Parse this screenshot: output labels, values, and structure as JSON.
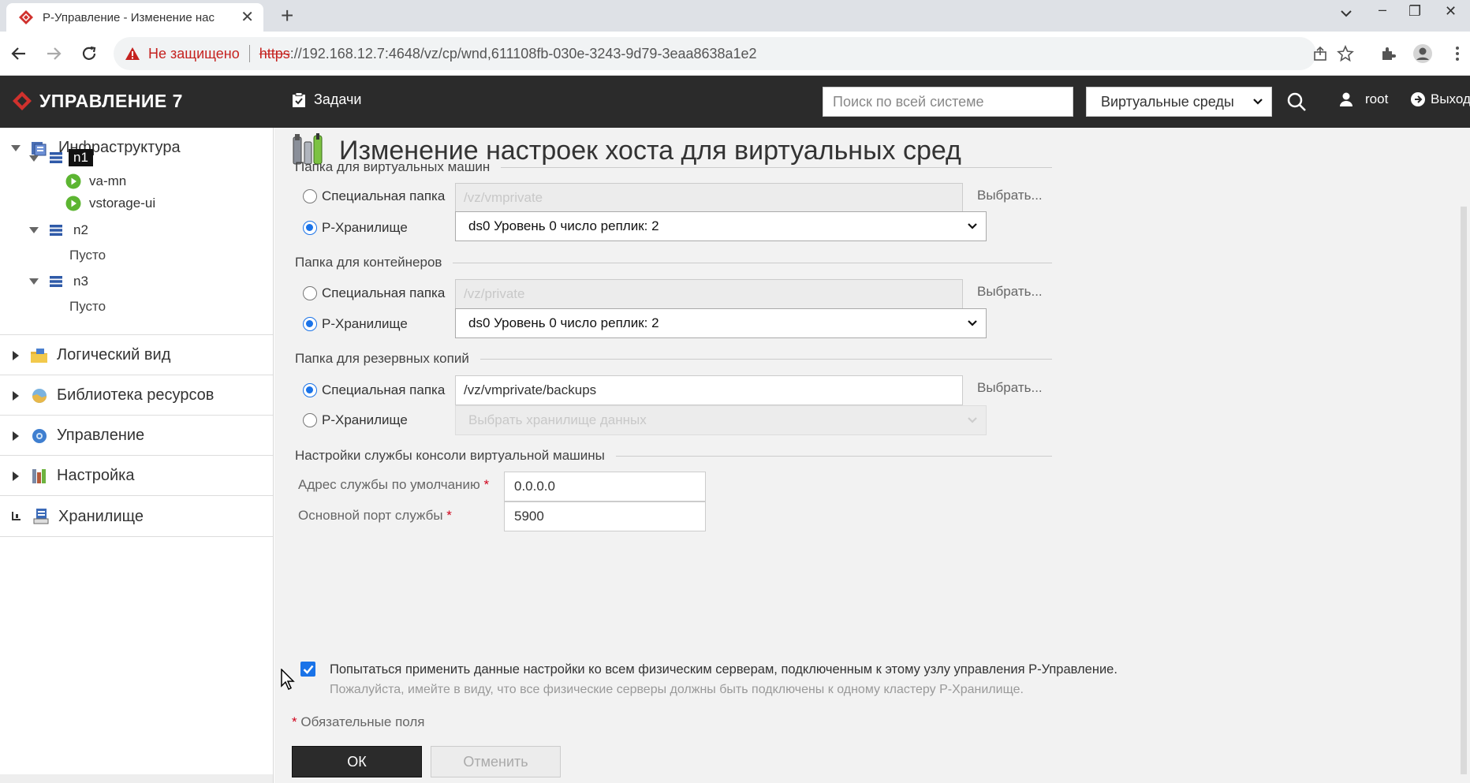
{
  "browser": {
    "tab_title": "Р-Управление - Изменение нас",
    "security_warning": "Не защищено",
    "url_scheme": "https",
    "url_rest": "://192.168.12.7:4648/vz/cp/wnd,611108fb-030e-3243-9d79-3eaa8638a1e2"
  },
  "header": {
    "app_title": "УПРАВЛЕНИЕ 7",
    "tasks_label": "Задачи",
    "search_placeholder": "Поиск по всей системе",
    "scope_select": "Виртуальные среды",
    "user": "root",
    "logout": "Выход"
  },
  "sidebar": {
    "infrastructure": "Инфраструктура",
    "nodes": [
      {
        "name": "n1",
        "children": [
          "va-mn",
          "vstorage-ui"
        ]
      },
      {
        "name": "n2",
        "empty": "Пусто"
      },
      {
        "name": "n3",
        "empty": "Пусто"
      }
    ],
    "sections": [
      "Логический вид",
      "Библиотека ресурсов",
      "Управление",
      "Настройка",
      "Хранилище"
    ]
  },
  "form": {
    "title": "Изменение настроек хоста для виртуальных сред",
    "vm_folder": {
      "heading": "Папка для виртуальных машин",
      "custom_label": "Специальная папка",
      "custom_value": "/vz/vmprivate",
      "storage_label": "Р-Хранилище",
      "storage_value": "ds0 Уровень 0 число реплик: 2",
      "selected": "storage"
    },
    "ct_folder": {
      "heading": "Папка для контейнеров",
      "custom_label": "Специальная папка",
      "custom_value": "/vz/private",
      "storage_label": "Р-Хранилище",
      "storage_value": "ds0 Уровень 0 число реплик: 2",
      "selected": "storage"
    },
    "backup_folder": {
      "heading": "Папка для резервных копий",
      "custom_label": "Специальная папка",
      "custom_value": "/vz/vmprivate/backups",
      "storage_label": "Р-Хранилище",
      "storage_value": "Выбрать хранилище данных",
      "selected": "custom"
    },
    "browse_label": "Выбрать...",
    "console": {
      "heading": "Настройки службы консоли виртуальной машины",
      "address_label": "Адрес службы по умолчанию",
      "address_value": "0.0.0.0",
      "port_label": "Основной порт службы",
      "port_value": "5900"
    },
    "apply_all_checked": true,
    "apply_all_text": "Попытаться применить данные настройки ко всем физическим серверам, подключенным к этому узлу управления Р-Управление.",
    "apply_all_note": "Пожалуйста, имейте в виду, что все физические серверы должны быть подключены к одному кластеру Р-Хранилище.",
    "required_mark": "*",
    "required_note": "Обязательные поля",
    "ok": "ОК",
    "cancel": "Отменить"
  },
  "colors": {
    "header_bg": "#2b2b2b",
    "brand_red": "#d0312d",
    "accent_blue": "#1a73e8",
    "content_bg": "#f2f2f2"
  }
}
